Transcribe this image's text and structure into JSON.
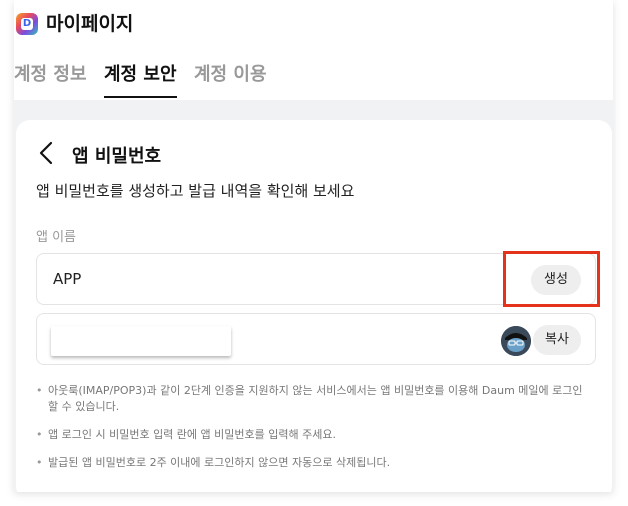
{
  "header": {
    "title": "마이페이지",
    "logo_letter": "D"
  },
  "tabs": [
    {
      "label": "계정 정보",
      "active": false
    },
    {
      "label": "계정 보안",
      "active": true
    },
    {
      "label": "계정 이용",
      "active": false
    }
  ],
  "card": {
    "title": "앱 비밀번호",
    "description": "앱 비밀번호를 생성하고 발급 내역을 확인해 보세요",
    "field_label": "앱 이름",
    "app_name_value": "APP",
    "generate_label": "생성",
    "copy_label": "복사"
  },
  "notes": [
    "아웃룩(IMAP/POP3)과 같이 2단계 인증을 지원하지 않는 서비스에서는 앱 비밀번호를 이용해 Daum 메일에 로그인 할 수 있습니다.",
    "앱 로그인 시 비밀번호 입력 란에 앱 비밀번호를 입력해 주세요.",
    "발급된 앱 비밀번호로 2주 이내에 로그인하지 않으면 자동으로 삭제됩니다."
  ],
  "colors": {
    "highlight": "#e4321b",
    "tab_inactive": "#999999",
    "content_bg": "#f1f2f4"
  }
}
